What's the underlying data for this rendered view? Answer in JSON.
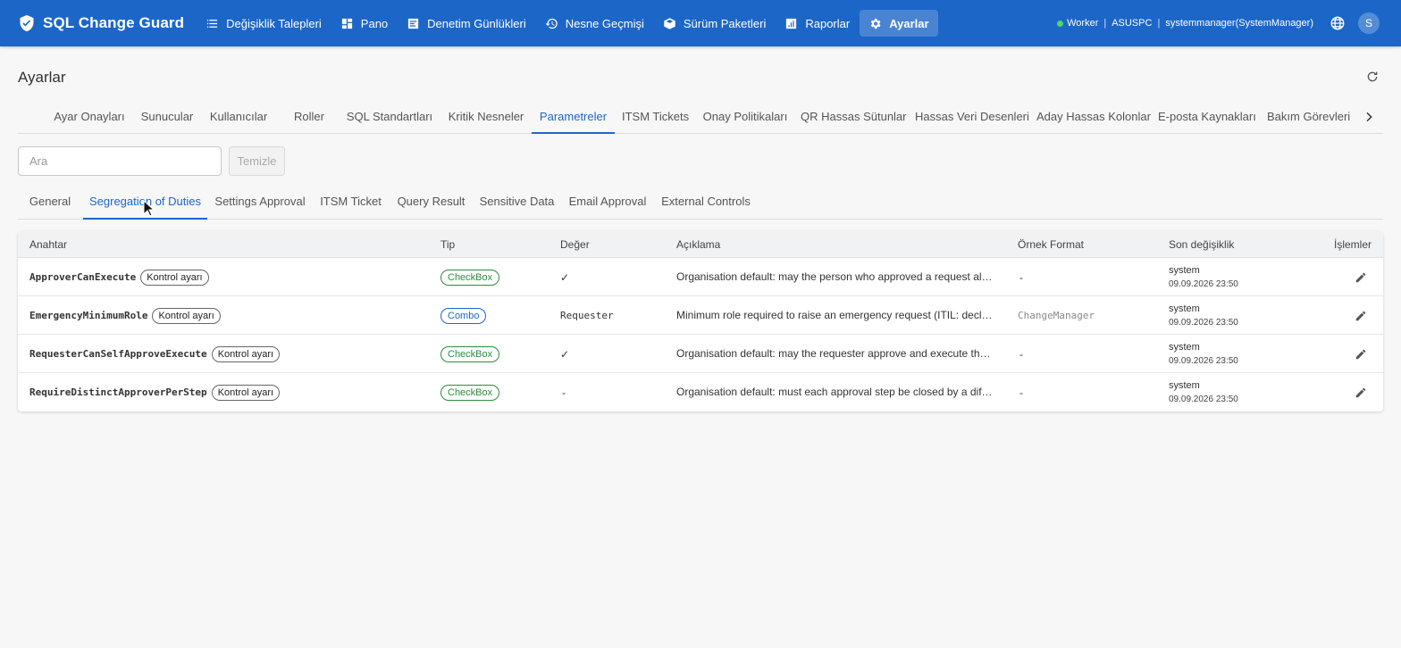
{
  "app": {
    "name": "SQL Change Guard"
  },
  "nav": [
    {
      "label": "Değişiklik Talepleri",
      "icon": "list-icon"
    },
    {
      "label": "Pano",
      "icon": "dashboard-icon"
    },
    {
      "label": "Denetim Günlükleri",
      "icon": "audit-icon"
    },
    {
      "label": "Nesne Geçmişi",
      "icon": "history-icon"
    },
    {
      "label": "Sürüm Paketleri",
      "icon": "package-icon"
    },
    {
      "label": "Raporlar",
      "icon": "chart-icon"
    },
    {
      "label": "Ayarlar",
      "icon": "gear-icon",
      "active": true
    }
  ],
  "status": {
    "worker": "Worker",
    "host": "ASUSPC",
    "separator": "|",
    "user": "systemmanager(SystemManager)",
    "avatar_letter": "S"
  },
  "page": {
    "title": "Ayarlar"
  },
  "main_tabs": [
    "Ayar Onayları",
    "Sunucular",
    "Kullanıcılar",
    "Roller",
    "SQL Standartları",
    "Kritik Nesneler",
    "Parametreler",
    "ITSM Tickets",
    "Onay Politikaları",
    "QR Hassas Sütunlar",
    "Hassas Veri Desenleri",
    "Aday Hassas Kolonlar",
    "E-posta Kaynakları",
    "Bakım Görevleri"
  ],
  "main_tab_active": "Parametreler",
  "search": {
    "placeholder": "Ara",
    "value": ""
  },
  "clear_label": "Temizle",
  "sub_tabs": [
    "General",
    "Segregation of Duties",
    "Settings Approval",
    "ITSM Ticket",
    "Query Result",
    "Sensitive Data",
    "Email Approval",
    "External Controls"
  ],
  "sub_tab_active": "Segregation of Duties",
  "table": {
    "columns": [
      "Anahtar",
      "Tip",
      "Değer",
      "Açıklama",
      "Örnek Format",
      "Son değişiklik",
      "İşlemler"
    ],
    "rows": [
      {
        "key": "ApproverCanExecute",
        "badge": "Kontrol ayarı",
        "type": "CheckBox",
        "value": "✓",
        "description": "Organisation default: may the person who approved a request also e...",
        "format": "-",
        "modified_by": "system",
        "modified_at": "09.09.2026 23:50"
      },
      {
        "key": "EmergencyMinimumRole",
        "badge": "Kontrol ayarı",
        "type": "Combo",
        "value": "Requester",
        "description": "Minimum role required to raise an emergency request (ITIL: declarin...",
        "format": "ChangeManager",
        "modified_by": "system",
        "modified_at": "09.09.2026 23:50"
      },
      {
        "key": "RequesterCanSelfApproveExecute",
        "badge": "Kontrol ayarı",
        "type": "CheckBox",
        "value": "✓",
        "description": "Organisation default: may the requester approve and execute their o...",
        "format": "-",
        "modified_by": "system",
        "modified_at": "09.09.2026 23:50"
      },
      {
        "key": "RequireDistinctApproverPerStep",
        "badge": "Kontrol ayarı",
        "type": "CheckBox",
        "value": "-",
        "description": "Organisation default: must each approval step be closed by a differe...",
        "format": "-",
        "modified_by": "system",
        "modified_at": "09.09.2026 23:50"
      }
    ]
  },
  "colors": {
    "primary": "#1c66c8",
    "checkbox": "#2e8b3d",
    "background": "#f7f7f8"
  }
}
